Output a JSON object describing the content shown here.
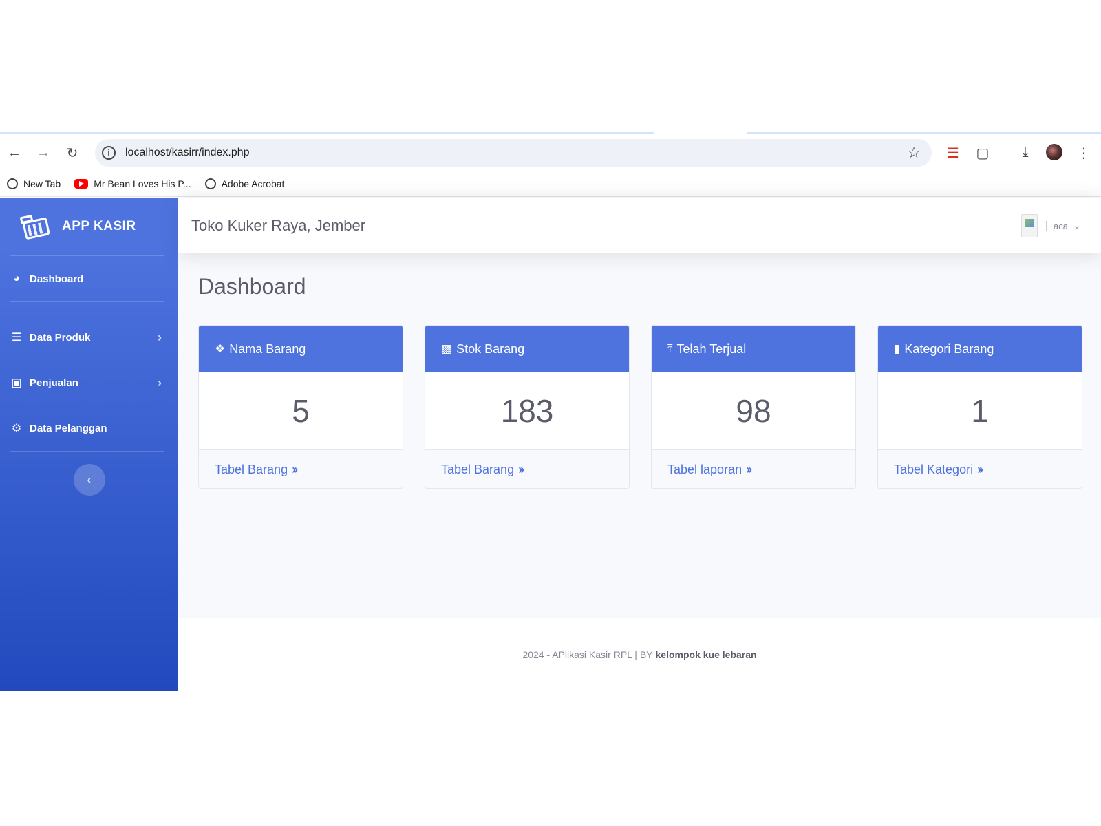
{
  "browser": {
    "url": "localhost/kasirr/index.php",
    "bookmarks": [
      {
        "label": "New Tab",
        "icon": "globe-icon"
      },
      {
        "label": "Mr Bean Loves His P...",
        "icon": "youtube-icon"
      },
      {
        "label": "Adobe Acrobat",
        "icon": "globe-icon"
      }
    ]
  },
  "brand": {
    "name": "APP KASIR",
    "icon": "cash-register-icon"
  },
  "sidebar": {
    "items": [
      {
        "label": "Dashboard",
        "icon": "tachometer-icon"
      },
      {
        "label": "Data Produk",
        "icon": "database-icon"
      },
      {
        "label": "Penjualan",
        "icon": "desktop-icon"
      },
      {
        "label": "Data Pelanggan",
        "icon": "cogs-icon"
      }
    ]
  },
  "topbar": {
    "store": "Toko Kuker Raya, Jember",
    "user": "aca"
  },
  "page": {
    "title": "Dashboard"
  },
  "cards": [
    {
      "title": "Nama Barang",
      "value": "5",
      "link": "Tabel Barang",
      "icon": "cubes-icon"
    },
    {
      "title": "Stok Barang",
      "value": "183",
      "link": "Tabel Barang",
      "icon": "chart-bar-icon"
    },
    {
      "title": "Telah Terjual",
      "value": "98",
      "link": "Tabel laporan",
      "icon": "upload-icon"
    },
    {
      "title": "Kategori Barang",
      "value": "1",
      "link": "Tabel Kategori",
      "icon": "bookmark-icon"
    }
  ],
  "footer": {
    "text": "2024 - APlikasi Kasir RPL | BY",
    "author": "kelompok kue lebaran"
  },
  "colors": {
    "primary": "#4e73df",
    "primary_dark": "#224abe",
    "bg": "#f8f9fc"
  }
}
